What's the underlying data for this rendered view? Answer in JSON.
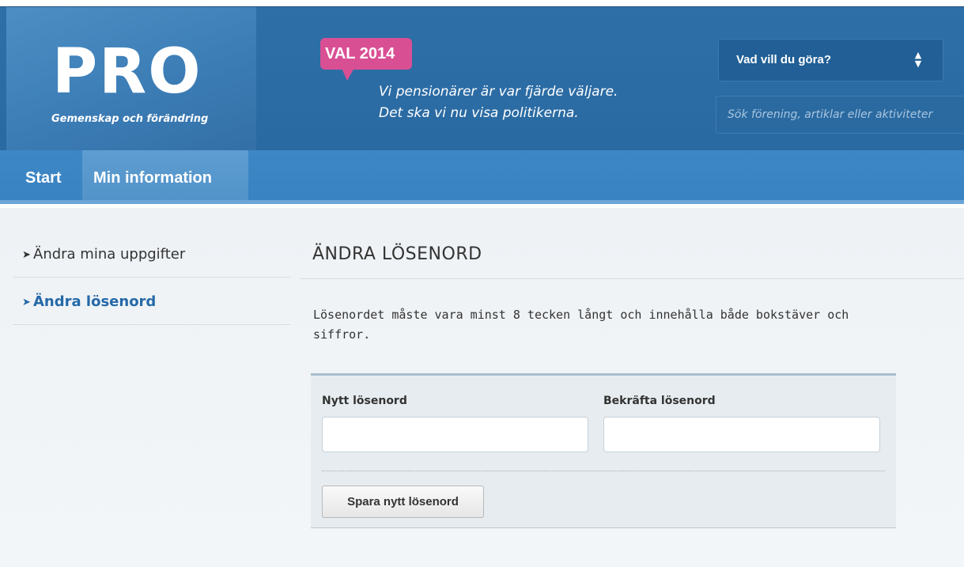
{
  "header": {
    "logo_text": "PRO",
    "logo_tagline": "Gemenskap och förändring",
    "campaign_badge": "VAL 2014",
    "slogan_line1": "Vi pensionärer är var fjärde väljare.",
    "slogan_line2": "Det ska vi nu visa politikerna.",
    "select_label": "Vad vill du göra?",
    "search_placeholder": "Sök förening, artiklar eller aktiviteter"
  },
  "nav": {
    "items": [
      {
        "label": "Start"
      },
      {
        "label": "Min information",
        "active": true
      }
    ]
  },
  "sidebar": {
    "items": [
      {
        "label": "Ändra mina uppgifter"
      },
      {
        "label": "Ändra lösenord",
        "active": true
      }
    ]
  },
  "main": {
    "heading": "ÄNDRA LÖSENORD",
    "description": "Lösenordet måste vara minst 8 tecken långt och innehålla både bokstäver och siffror.",
    "form": {
      "new_password_label": "Nytt lösenord",
      "new_password_value": "",
      "confirm_password_label": "Bekräfta lösenord",
      "confirm_password_value": "",
      "submit_label": "Spara nytt lösenord"
    }
  },
  "colors": {
    "header_blue": "#2e6fa7",
    "nav_blue": "#3d87c6",
    "badge_pink": "#d94f94",
    "active_link": "#2569a8"
  },
  "icons": {
    "select_arrows": "updown-arrows-icon",
    "sidebar_chevron": "chevron-right-icon"
  }
}
